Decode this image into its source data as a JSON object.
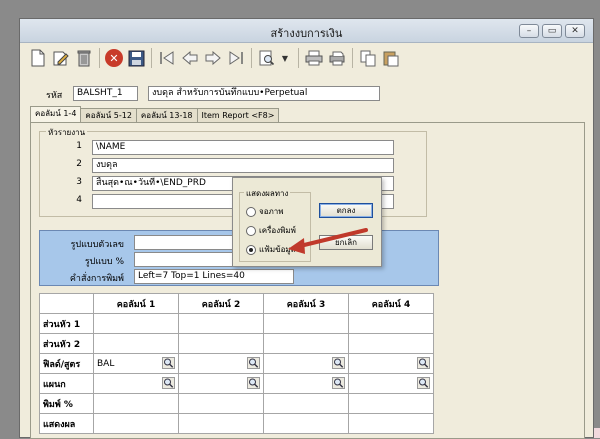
{
  "window": {
    "title": "สร้างงบการเงิน"
  },
  "window_buttons": {
    "minimize": "–",
    "restore": "▭",
    "close": "✕"
  },
  "toolbar": {
    "icons": [
      "new-document-icon",
      "edit-icon",
      "delete-bin-icon",
      "stop-icon",
      "save-icon",
      "first-record-icon",
      "previous-record-icon",
      "next-record-icon",
      "last-record-icon",
      "search-icon",
      "print-icon",
      "print-setup-icon",
      "copy-icon",
      "paste-icon"
    ]
  },
  "header": {
    "code_label": "รหัส",
    "code_value": "BALSHT_1",
    "name_value": "งบดุล สำหรับการบันทึกแบบ•Perpetual"
  },
  "tabs": [
    "คอลัมน์ 1-4",
    "คอลัมน์ 5-12",
    "คอลัมน์ 13-18",
    "Item Report <F8>"
  ],
  "report_header": {
    "group_title": "หัวรายงาน",
    "rows": [
      {
        "num": "1",
        "value": "\\NAME"
      },
      {
        "num": "2",
        "value": "งบดุล"
      },
      {
        "num": "3",
        "value": "สิ้นสุด•ณ•วันที่•\\END_PRD"
      },
      {
        "num": "4",
        "value": ""
      }
    ]
  },
  "format": {
    "number_format_label": "รูปแบบตัวเลข",
    "number_format_value": "",
    "percent_format_label": "รูปแบบ %",
    "percent_format_value": "",
    "print_command_label": "คำสั่งการพิมพ์",
    "print_command_value": "Left=7 Top=1 Lines=40"
  },
  "grid": {
    "columns": [
      "คอลัมน์ 1",
      "คอลัมน์ 2",
      "คอลัมน์ 3",
      "คอลัมน์ 4"
    ],
    "rows": [
      {
        "label": "ส่วนหัว 1",
        "cells": [
          "",
          "",
          "",
          ""
        ],
        "lookup": false
      },
      {
        "label": "ส่วนหัว 2",
        "cells": [
          "",
          "",
          "",
          ""
        ],
        "lookup": false
      },
      {
        "label": "ฟิลด์/สูตร",
        "cells": [
          "BAL",
          "",
          "",
          ""
        ],
        "lookup": true
      },
      {
        "label": "แผนก",
        "cells": [
          "",
          "",
          "",
          ""
        ],
        "lookup": true
      },
      {
        "label": "พิมพ์ %",
        "cells": [
          "",
          "",
          "",
          ""
        ],
        "lookup": false
      },
      {
        "label": "แสดงผล",
        "cells": [
          "",
          "",
          "",
          ""
        ],
        "lookup": false
      }
    ]
  },
  "dialog": {
    "group_title": "แสดงผลทาง",
    "options": [
      {
        "label": "จอภาพ",
        "selected": false
      },
      {
        "label": "เครื่องพิมพ์",
        "selected": false
      },
      {
        "label": "แฟ้มข้อมูล",
        "selected": true
      }
    ],
    "ok_label": "ตกลง",
    "cancel_label": "ยกเลิก"
  },
  "colors": {
    "accent_blue": "#a7c7ea",
    "arrow_red": "#c0392b",
    "window_bg": "#f0ecdc"
  }
}
